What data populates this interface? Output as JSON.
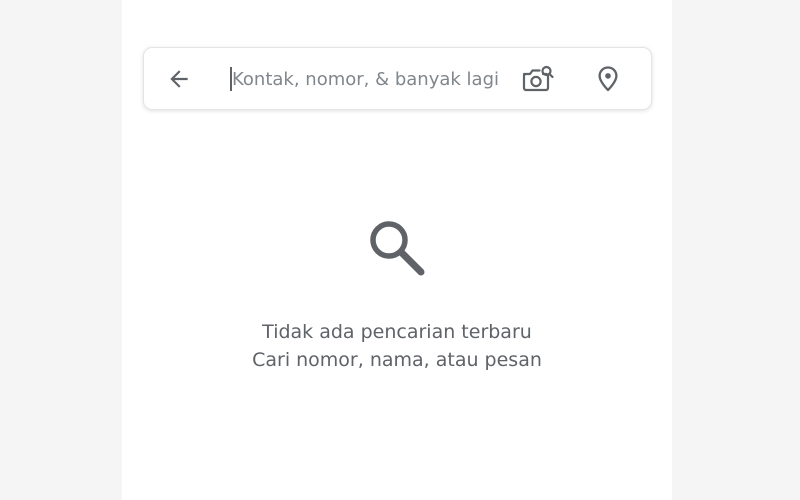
{
  "search": {
    "value": "",
    "placeholder": "Kontak, nomor, & banyak lagi"
  },
  "icons": {
    "back": "arrow-back-icon",
    "camera_search": "camera-search-icon",
    "location": "location-pin-icon",
    "empty_state": "search-icon"
  },
  "empty_state": {
    "title": "Tidak ada pencarian terbaru",
    "subtitle": "Cari nomor, nama, atau pesan"
  },
  "colors": {
    "icon": "#5f6368",
    "text": "#5f6368",
    "background": "#ffffff"
  }
}
